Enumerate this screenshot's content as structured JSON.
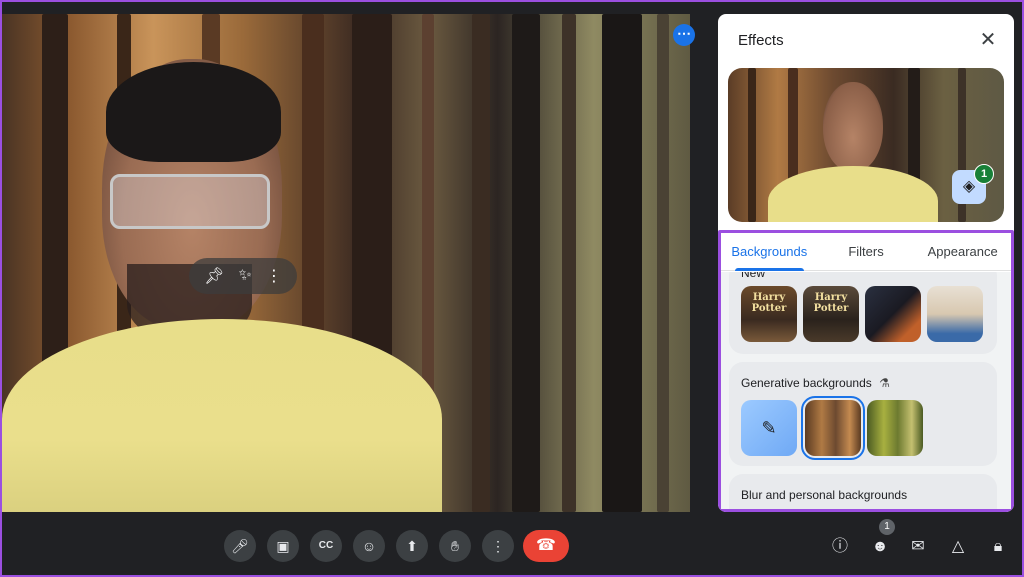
{
  "effects": {
    "title": "Effects",
    "layers_badge_count": "1",
    "tabs": [
      {
        "label": "Backgrounds"
      },
      {
        "label": "Filters"
      },
      {
        "label": "Appearance"
      }
    ],
    "sections": {
      "new_label": "New",
      "new_thumbs": [
        {
          "text": "Harry Potter"
        },
        {
          "text": "Harry Potter"
        },
        {
          "text": ""
        },
        {
          "text": ""
        }
      ],
      "generative_label": "Generative backgrounds",
      "blur_label": "Blur and personal backgrounds"
    }
  },
  "bottom_bar": {
    "people_count": "1"
  },
  "icons": {
    "pin": "pin-icon",
    "sparkle": "sparkle-icon",
    "more": "more-vert-icon",
    "mic": "mic-icon",
    "camera": "camera-icon",
    "captions": "captions-icon",
    "emoji": "emoji-icon",
    "present": "present-icon",
    "hand": "raise-hand-icon",
    "end_call": "end-call-icon",
    "info": "info-icon",
    "people": "people-icon",
    "chat": "chat-icon",
    "activities": "activities-icon",
    "lock": "host-controls-icon"
  },
  "colors": {
    "accent": "#1a73e8",
    "highlight": "#9b4fe0",
    "end_call": "#ea4335",
    "badge_green": "#188038"
  }
}
